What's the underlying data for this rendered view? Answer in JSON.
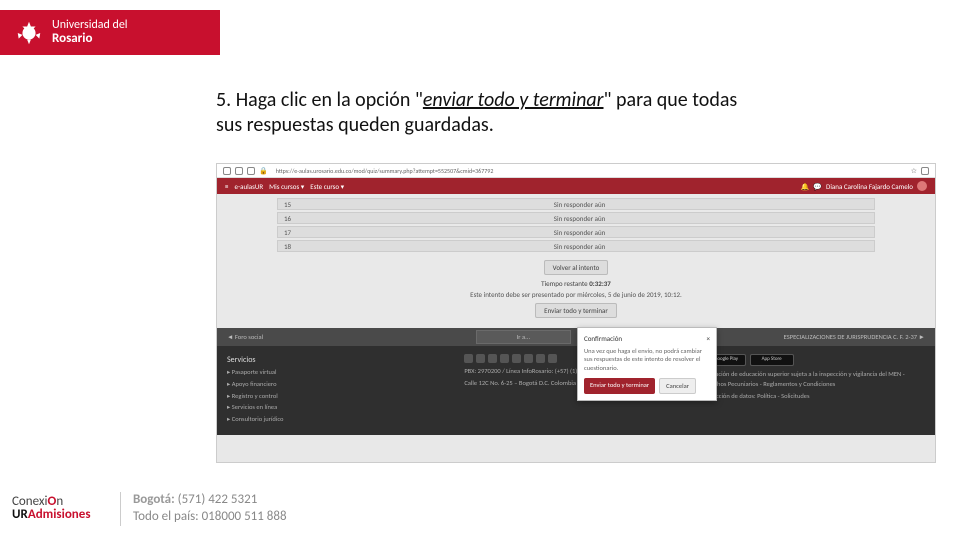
{
  "header": {
    "university_line1": "Universidad del",
    "university_line2": "Rosario"
  },
  "instruction": {
    "prefix": "5. Haga clic en la opción \"",
    "link_text": "enviar todo y terminar",
    "suffix": "\" para que todas sus respuestas queden guardadas."
  },
  "screenshot": {
    "browser": {
      "url": "https://e-aulas.urosario.edu.co/mod/quiz/summary.php?attempt=552507&cmid=367792"
    },
    "navbar": {
      "brand": "e-aulasUR",
      "menu1": "Mis cursos ▾",
      "menu2": "Este curso ▾",
      "username": "Diana Carolina Fajardo Camelo"
    },
    "questions": [
      {
        "num": "15",
        "status": "Sin responder aún"
      },
      {
        "num": "16",
        "status": "Sin responder aún"
      },
      {
        "num": "17",
        "status": "Sin responder aún"
      },
      {
        "num": "18",
        "status": "Sin responder aún"
      }
    ],
    "return_button": "Volver al intento",
    "time_label": "Tiempo restante",
    "time_value": "0:32:37",
    "deadline_note": "Este intento debe ser presentado por miércoles, 5 de junio de 2019, 10:12.",
    "submit_button": "Enviar todo y terminar",
    "breadcrumb_left": "◄ Foro social",
    "breadcrumb_mid": "Ir a...",
    "breadcrumb_right": "ESPECIALIZACIONES DE JURISPRUDENCIA C. F. 2-37 ►",
    "modal": {
      "title": "Confirmación",
      "close": "×",
      "text": "Una vez que haga el envío, no podrá cambiar sus respuestas de este intento de resolver el cuestionario.",
      "primary": "Enviar todo y terminar",
      "secondary": "Cancelar"
    },
    "footer": {
      "services_title": "Servicios",
      "services": [
        "▸ Pasaporte virtual",
        "▸ Apoyo financiero",
        "▸ Registro y control",
        "▸ Servicios en línea",
        "▸ Consultorio jurídico"
      ],
      "pbx": "PBX: 2970200 / Línea InfoRosario: (+57) (1) 4225321 / 018000 511888",
      "addr": "Calle 12C No. 6-25 – Bogotá D.C. Colombia – sedes",
      "store_google": "▶ Google Play",
      "store_apple": " App Store",
      "legal1": "Institución de educación superior sujeta a la inspección y vigilancia del MEN - Derechos Pecuniarios - Reglamentos y Condiciones",
      "legal2": "Protección de datos: Política - Solicitudes"
    }
  },
  "bottom_logo": {
    "line1a": "Conexi",
    "line1b": "O",
    "line1c": "n",
    "line2a": "UR",
    "line2b": "Admisiones"
  },
  "contact": {
    "line1_label": "Bogotá:",
    "line1_val": " (571) 422 5321",
    "line2": "Todo el país: 018000 511 888"
  }
}
